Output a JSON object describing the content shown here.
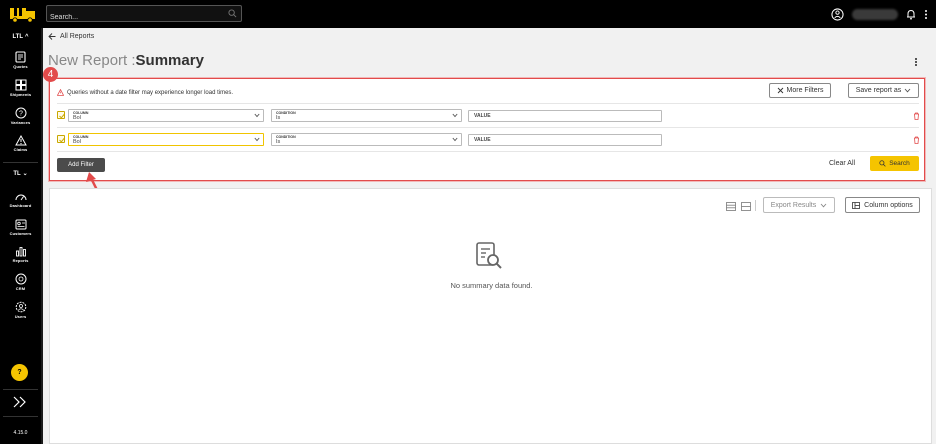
{
  "topbar": {
    "search_placeholder": "Search..."
  },
  "sidebar": {
    "group_ltl": "LTL",
    "group_tl": "TL",
    "items": [
      {
        "label": "Quotes"
      },
      {
        "label": "Shipments"
      },
      {
        "label": "Variances"
      },
      {
        "label": "Claims"
      },
      {
        "label": "Dashboard"
      },
      {
        "label": "Customers"
      },
      {
        "label": "Reports"
      },
      {
        "label": "CRM"
      },
      {
        "label": "Users"
      }
    ],
    "help_label": "?",
    "version": "4.15.0"
  },
  "page": {
    "breadcrumb": "All Reports",
    "title_prefix": "New Report :",
    "title_main": "Summary"
  },
  "filters": {
    "warning": "Queries without a date filter may experience longer load times.",
    "more_filters": "More Filters",
    "save_report_as": "Save report as",
    "rows": [
      {
        "column_caption": "COLUMN",
        "column_value": "Bol",
        "condition_caption": "CONDITION",
        "condition_value": "Is",
        "value_placeholder": "VALUE"
      },
      {
        "column_caption": "COLUMN",
        "column_value": "Bol",
        "condition_caption": "CONDITION",
        "condition_value": "Is",
        "value_placeholder": "VALUE"
      }
    ],
    "add_filter": "Add Filter",
    "clear_all": "Clear All",
    "search": "Search"
  },
  "annotation": {
    "step": "4"
  },
  "results": {
    "export_results": "Export Results",
    "column_options": "Column options",
    "empty_message": "No summary data found."
  },
  "colors": {
    "accent_yellow": "#f5c400",
    "annotation_red": "#e24b4b",
    "sidebar_bg": "#000000"
  }
}
